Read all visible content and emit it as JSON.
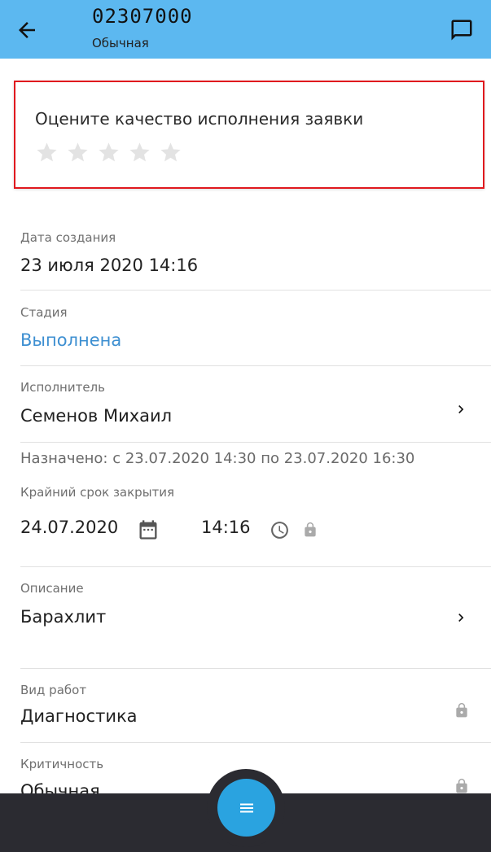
{
  "header": {
    "title": "02307000",
    "subtitle": "Обычная",
    "back_icon": "arrow-left-icon",
    "chat_icon": "chat-icon",
    "background_color": "#5cb8f0"
  },
  "rating": {
    "question": "Оцените качество исполнения заявки",
    "stars_total": 5,
    "stars_selected": 0,
    "border_color": "#e0191e"
  },
  "fields": {
    "created": {
      "label": "Дата создания",
      "value": "23 июля 2020 14:16"
    },
    "stage": {
      "label": "Стадия",
      "value": "Выполнена",
      "color": "#3d8fd1"
    },
    "executor": {
      "label": "Исполнитель",
      "value": "Семенов Михаил"
    },
    "assigned": "Назначено: с 23.07.2020 14:30 по 23.07.2020 16:30",
    "deadline": {
      "label": "Крайний срок закрытия",
      "date": "24.07.2020",
      "time": "14:16",
      "locked": true
    },
    "description": {
      "label": "Описание",
      "value": "Барахлит"
    },
    "work_type": {
      "label": "Вид работ",
      "value": "Диагностика",
      "locked": true
    },
    "criticality": {
      "label": "Критичность",
      "value": "Обычная",
      "locked": true
    }
  },
  "bottom_bar": {
    "menu_icon": "menu-icon",
    "fab_color": "#2aa3e0"
  }
}
